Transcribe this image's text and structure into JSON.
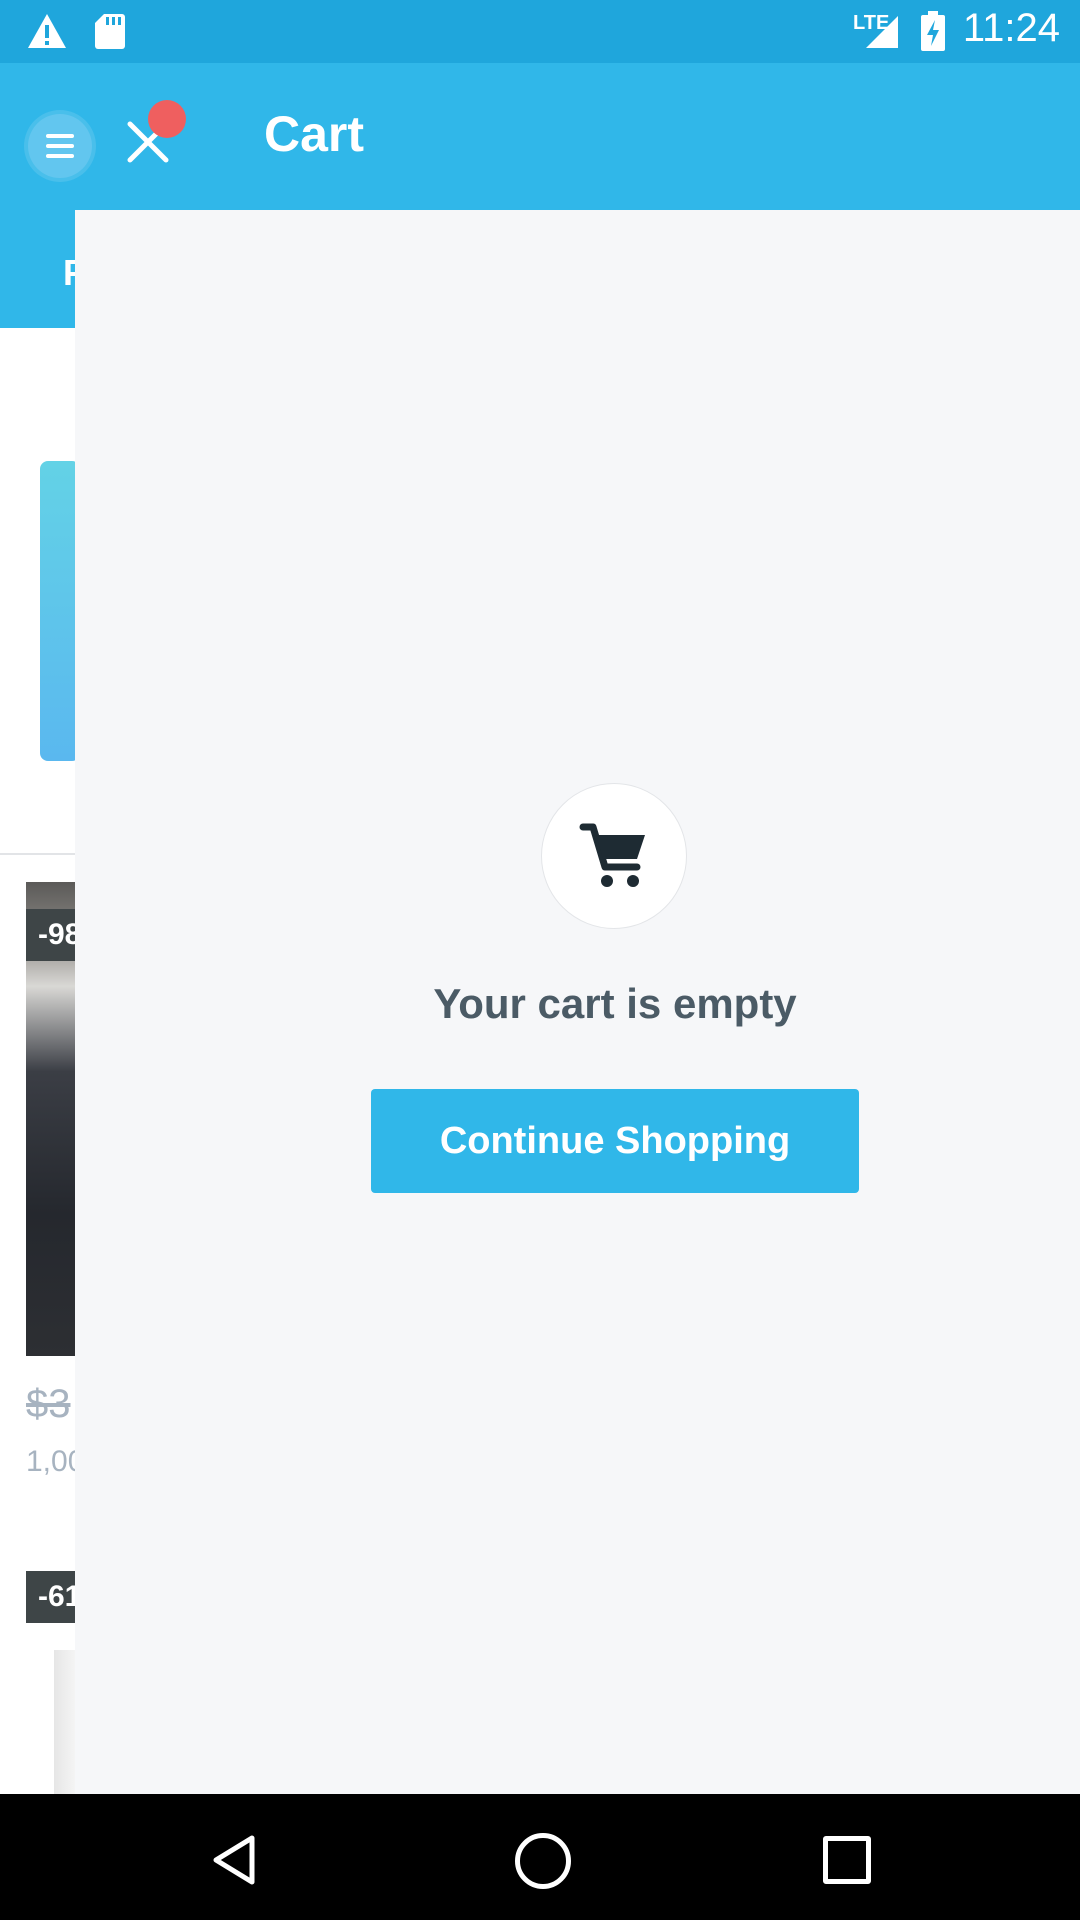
{
  "status_bar": {
    "time": "11:24",
    "network": "LTE",
    "icons": [
      "warning-icon",
      "sd-card-icon",
      "signal-icon",
      "battery-charging-icon"
    ]
  },
  "app_bar": {
    "title": "Cart",
    "menu_icon": "menu-icon",
    "close_icon": "close-icon",
    "accent_color": "#30b7e9"
  },
  "background_page": {
    "tab_fragment": "F",
    "deal_tag_1": "-98",
    "price_fragment": "$3",
    "sold_fragment": "1,00",
    "deal_tag_2": "-61"
  },
  "cart": {
    "empty_icon": "shopping-cart-icon",
    "empty_message": "Your cart is empty",
    "continue_label": "Continue Shopping"
  },
  "nav_bar": {
    "icons": [
      "back-icon",
      "home-icon",
      "recent-apps-icon"
    ]
  }
}
